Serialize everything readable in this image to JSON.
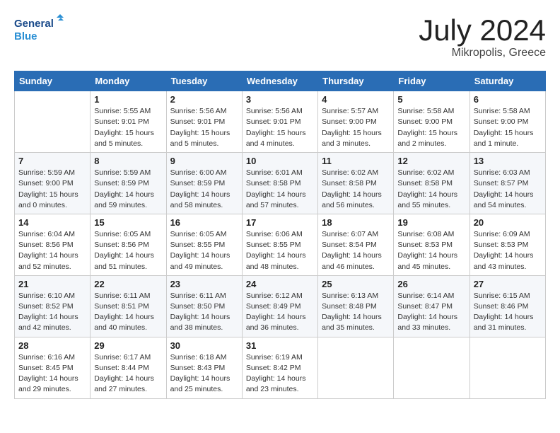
{
  "logo": {
    "general": "General",
    "blue": "Blue"
  },
  "title": {
    "month_year": "July 2024",
    "location": "Mikropolis, Greece"
  },
  "calendar": {
    "headers": [
      "Sunday",
      "Monday",
      "Tuesday",
      "Wednesday",
      "Thursday",
      "Friday",
      "Saturday"
    ],
    "weeks": [
      [
        {
          "day": "",
          "info": ""
        },
        {
          "day": "1",
          "info": "Sunrise: 5:55 AM\nSunset: 9:01 PM\nDaylight: 15 hours\nand 5 minutes."
        },
        {
          "day": "2",
          "info": "Sunrise: 5:56 AM\nSunset: 9:01 PM\nDaylight: 15 hours\nand 5 minutes."
        },
        {
          "day": "3",
          "info": "Sunrise: 5:56 AM\nSunset: 9:01 PM\nDaylight: 15 hours\nand 4 minutes."
        },
        {
          "day": "4",
          "info": "Sunrise: 5:57 AM\nSunset: 9:00 PM\nDaylight: 15 hours\nand 3 minutes."
        },
        {
          "day": "5",
          "info": "Sunrise: 5:58 AM\nSunset: 9:00 PM\nDaylight: 15 hours\nand 2 minutes."
        },
        {
          "day": "6",
          "info": "Sunrise: 5:58 AM\nSunset: 9:00 PM\nDaylight: 15 hours\nand 1 minute."
        }
      ],
      [
        {
          "day": "7",
          "info": "Sunrise: 5:59 AM\nSunset: 9:00 PM\nDaylight: 15 hours\nand 0 minutes."
        },
        {
          "day": "8",
          "info": "Sunrise: 5:59 AM\nSunset: 8:59 PM\nDaylight: 14 hours\nand 59 minutes."
        },
        {
          "day": "9",
          "info": "Sunrise: 6:00 AM\nSunset: 8:59 PM\nDaylight: 14 hours\nand 58 minutes."
        },
        {
          "day": "10",
          "info": "Sunrise: 6:01 AM\nSunset: 8:58 PM\nDaylight: 14 hours\nand 57 minutes."
        },
        {
          "day": "11",
          "info": "Sunrise: 6:02 AM\nSunset: 8:58 PM\nDaylight: 14 hours\nand 56 minutes."
        },
        {
          "day": "12",
          "info": "Sunrise: 6:02 AM\nSunset: 8:58 PM\nDaylight: 14 hours\nand 55 minutes."
        },
        {
          "day": "13",
          "info": "Sunrise: 6:03 AM\nSunset: 8:57 PM\nDaylight: 14 hours\nand 54 minutes."
        }
      ],
      [
        {
          "day": "14",
          "info": "Sunrise: 6:04 AM\nSunset: 8:56 PM\nDaylight: 14 hours\nand 52 minutes."
        },
        {
          "day": "15",
          "info": "Sunrise: 6:05 AM\nSunset: 8:56 PM\nDaylight: 14 hours\nand 51 minutes."
        },
        {
          "day": "16",
          "info": "Sunrise: 6:05 AM\nSunset: 8:55 PM\nDaylight: 14 hours\nand 49 minutes."
        },
        {
          "day": "17",
          "info": "Sunrise: 6:06 AM\nSunset: 8:55 PM\nDaylight: 14 hours\nand 48 minutes."
        },
        {
          "day": "18",
          "info": "Sunrise: 6:07 AM\nSunset: 8:54 PM\nDaylight: 14 hours\nand 46 minutes."
        },
        {
          "day": "19",
          "info": "Sunrise: 6:08 AM\nSunset: 8:53 PM\nDaylight: 14 hours\nand 45 minutes."
        },
        {
          "day": "20",
          "info": "Sunrise: 6:09 AM\nSunset: 8:53 PM\nDaylight: 14 hours\nand 43 minutes."
        }
      ],
      [
        {
          "day": "21",
          "info": "Sunrise: 6:10 AM\nSunset: 8:52 PM\nDaylight: 14 hours\nand 42 minutes."
        },
        {
          "day": "22",
          "info": "Sunrise: 6:11 AM\nSunset: 8:51 PM\nDaylight: 14 hours\nand 40 minutes."
        },
        {
          "day": "23",
          "info": "Sunrise: 6:11 AM\nSunset: 8:50 PM\nDaylight: 14 hours\nand 38 minutes."
        },
        {
          "day": "24",
          "info": "Sunrise: 6:12 AM\nSunset: 8:49 PM\nDaylight: 14 hours\nand 36 minutes."
        },
        {
          "day": "25",
          "info": "Sunrise: 6:13 AM\nSunset: 8:48 PM\nDaylight: 14 hours\nand 35 minutes."
        },
        {
          "day": "26",
          "info": "Sunrise: 6:14 AM\nSunset: 8:47 PM\nDaylight: 14 hours\nand 33 minutes."
        },
        {
          "day": "27",
          "info": "Sunrise: 6:15 AM\nSunset: 8:46 PM\nDaylight: 14 hours\nand 31 minutes."
        }
      ],
      [
        {
          "day": "28",
          "info": "Sunrise: 6:16 AM\nSunset: 8:45 PM\nDaylight: 14 hours\nand 29 minutes."
        },
        {
          "day": "29",
          "info": "Sunrise: 6:17 AM\nSunset: 8:44 PM\nDaylight: 14 hours\nand 27 minutes."
        },
        {
          "day": "30",
          "info": "Sunrise: 6:18 AM\nSunset: 8:43 PM\nDaylight: 14 hours\nand 25 minutes."
        },
        {
          "day": "31",
          "info": "Sunrise: 6:19 AM\nSunset: 8:42 PM\nDaylight: 14 hours\nand 23 minutes."
        },
        {
          "day": "",
          "info": ""
        },
        {
          "day": "",
          "info": ""
        },
        {
          "day": "",
          "info": ""
        }
      ]
    ]
  }
}
